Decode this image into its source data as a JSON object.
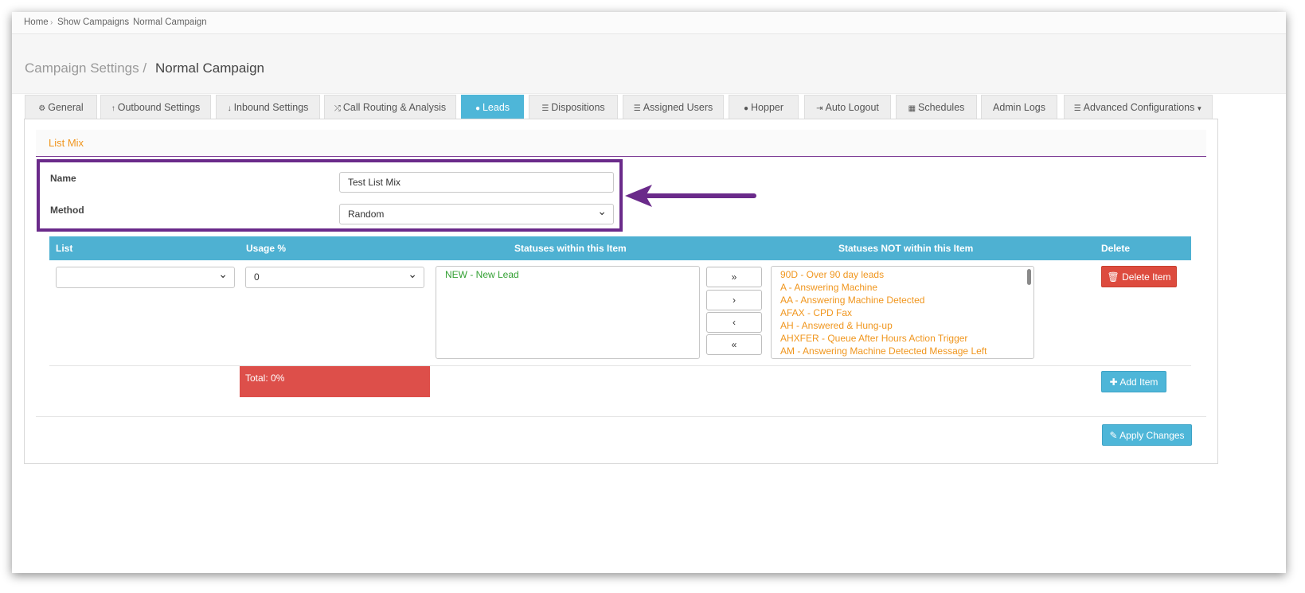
{
  "breadcrumb": {
    "items": [
      "Home",
      "Show Campaigns",
      "Normal Campaign"
    ],
    "separator": "›"
  },
  "header": {
    "section": "Campaign Settings /",
    "campaign": "Normal Campaign"
  },
  "tabs": [
    {
      "label": "General",
      "icon": "gears-icon"
    },
    {
      "label": "Outbound Settings",
      "icon": "arrow-up-icon"
    },
    {
      "label": "Inbound Settings",
      "icon": "arrow-down-icon"
    },
    {
      "label": "Call Routing & Analysis",
      "icon": "shuffle-icon"
    },
    {
      "label": "Leads",
      "icon": "users-icon",
      "active": true
    },
    {
      "label": "Dispositions",
      "icon": "list-icon"
    },
    {
      "label": "Assigned Users",
      "icon": "ordered-list-icon"
    },
    {
      "label": "Hopper",
      "icon": "users-icon"
    },
    {
      "label": "Auto Logout",
      "icon": "sign-out-icon"
    },
    {
      "label": "Schedules",
      "icon": "calendar-icon"
    },
    {
      "label": "Admin Logs",
      "icon": ""
    },
    {
      "label": "Advanced Configurations",
      "icon": "server-icon"
    }
  ],
  "list_mix": {
    "title": "List Mix",
    "name_label": "Name",
    "name_value": "Test List Mix",
    "method_label": "Method",
    "method_value": "Random"
  },
  "table": {
    "headers": {
      "list": "List",
      "usage": "Usage %",
      "within": "Statuses within this Item",
      "not_within": "Statuses NOT within this Item",
      "delete": "Delete"
    },
    "row": {
      "list_value": "",
      "usage_value": "0",
      "within_statuses": [
        "NEW - New Lead"
      ],
      "not_within_statuses": [
        "90D - Over 90 day leads",
        "A - Answering Machine",
        "AA - Answering Machine Detected",
        "AFAX - CPD Fax",
        "AH - Answered & Hung-up",
        "AHXFER - Queue After Hours Action Trigger",
        "AM - Answering Machine Detected Message Left"
      ],
      "move_buttons": [
        "»",
        "›",
        "‹",
        "«"
      ],
      "delete_label": "Delete Item"
    },
    "total_label": "Total: 0%",
    "add_item_label": "Add Item"
  },
  "apply_label": "Apply Changes",
  "colors": {
    "accent": "#4eb6d8",
    "danger": "#dd4b3e",
    "highlight": "#6a2a8a",
    "status_in": "#33a033",
    "status_out": "#f0961e"
  }
}
